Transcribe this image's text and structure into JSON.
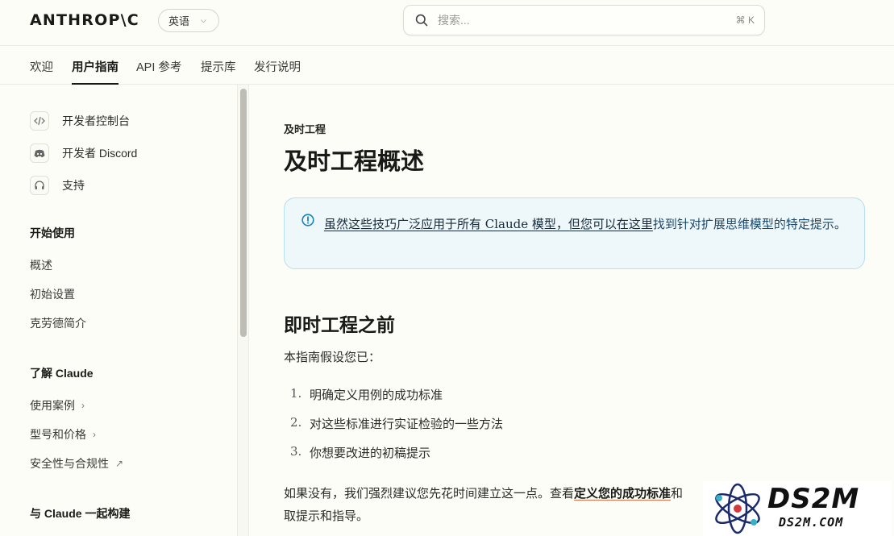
{
  "header": {
    "logo": "ANTHROP\\C",
    "language": "英语",
    "search_placeholder": "搜索...",
    "search_shortcut": "⌘ K"
  },
  "tabs": [
    {
      "label": "欢迎"
    },
    {
      "label": "用户指南",
      "active": true
    },
    {
      "label": "API 参考"
    },
    {
      "label": "提示库"
    },
    {
      "label": "发行说明"
    }
  ],
  "sidebar": {
    "links": [
      {
        "label": "开发者控制台",
        "icon": "code-icon"
      },
      {
        "label": "开发者 Discord",
        "icon": "discord-icon"
      },
      {
        "label": "支持",
        "icon": "headset-icon"
      }
    ],
    "sections": [
      {
        "heading": "开始使用",
        "items": [
          "概述",
          "初始设置",
          "克劳德简介"
        ]
      },
      {
        "heading": "了解 Claude",
        "items": [
          "使用案例",
          "型号和价格",
          "安全性与合规性"
        ]
      },
      {
        "heading": "与 Claude 一起构建",
        "items": []
      }
    ]
  },
  "main": {
    "eyebrow": "及时工程",
    "title": "及时工程概述",
    "callout": {
      "underlined": "虽然这些技巧广泛应用于所有 Claude 模型，但您可以在这里",
      "link": "找到针对扩展思维模型的特定提示",
      "end": "。"
    },
    "section_title": "即时工程之前",
    "intro": "本指南假设您已：",
    "list": [
      {
        "num": "1.",
        "text": "明确定义用例的成功标准"
      },
      {
        "num": "2.",
        "text": "对这些标准进行实证检验的一些方法"
      },
      {
        "num": "3.",
        "text": "你想要改进的初稿提示"
      }
    ],
    "tail": {
      "before": "如果没有，我们强烈建议您先花时间建立这一点。查看",
      "link": "定义您的成功标准",
      "after": "和",
      "line2": "取提示和指导。"
    }
  },
  "watermark": {
    "big": "DS2M",
    "small": "DS2M.COM"
  }
}
